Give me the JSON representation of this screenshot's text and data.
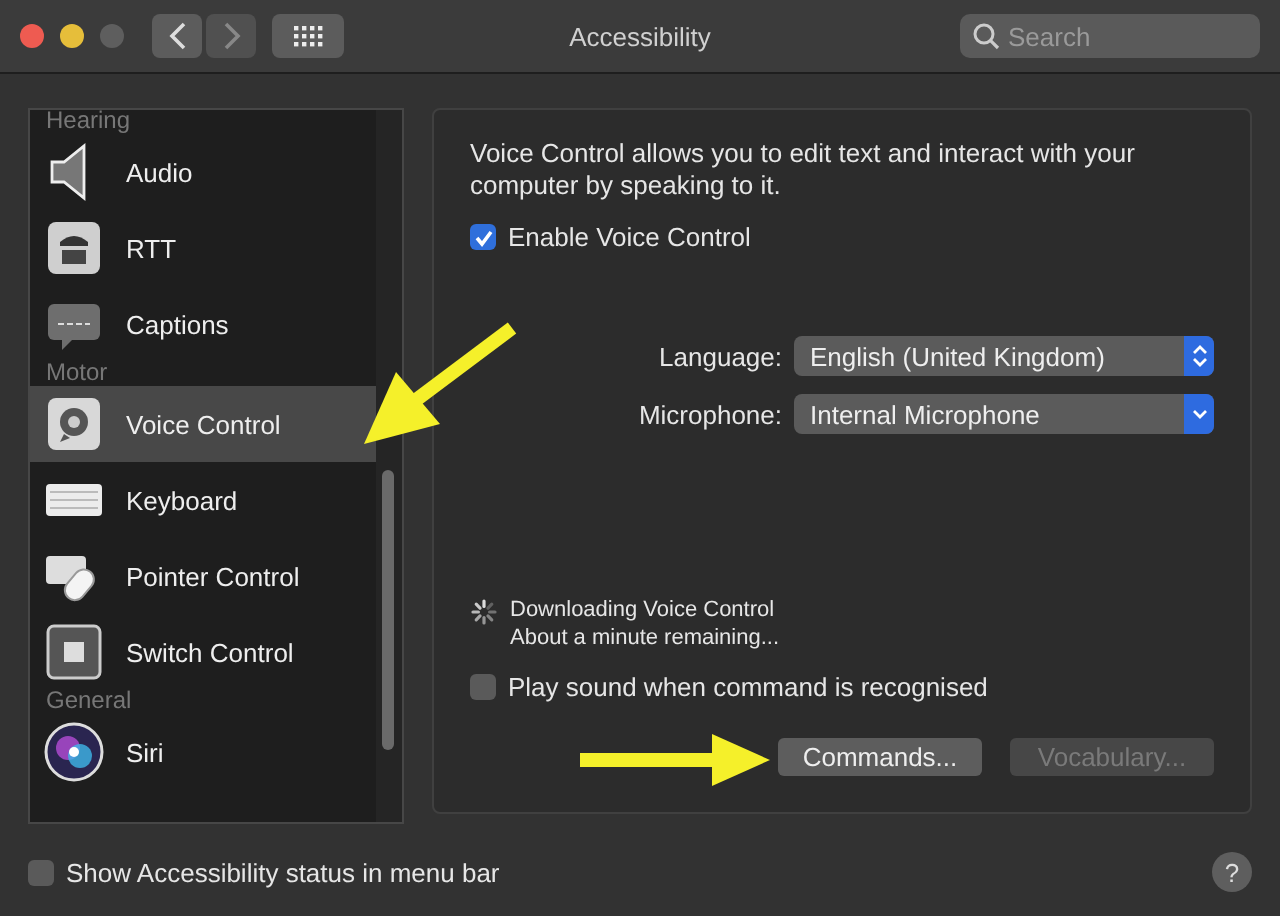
{
  "window": {
    "title": "Accessibility"
  },
  "toolbar": {
    "search": {
      "placeholder": "Search"
    }
  },
  "sidebar": {
    "items": [
      {
        "kind": "section",
        "label": "Hearing"
      },
      {
        "kind": "item",
        "label": "Audio",
        "selected": false
      },
      {
        "kind": "item",
        "label": "RTT",
        "selected": false
      },
      {
        "kind": "item",
        "label": "Captions",
        "selected": false
      },
      {
        "kind": "section",
        "label": "Motor"
      },
      {
        "kind": "item",
        "label": "Voice Control",
        "selected": true
      },
      {
        "kind": "item",
        "label": "Keyboard",
        "selected": false
      },
      {
        "kind": "item",
        "label": "Pointer Control",
        "selected": false
      },
      {
        "kind": "item",
        "label": "Switch Control",
        "selected": false
      },
      {
        "kind": "section",
        "label": "General"
      },
      {
        "kind": "item",
        "label": "Siri",
        "selected": false
      }
    ]
  },
  "panel": {
    "description": "Voice Control allows you to edit text and interact with your computer by speaking to it.",
    "enable": {
      "label": "Enable Voice Control",
      "checked": true
    },
    "language": {
      "label": "Language:",
      "value": "English (United Kingdom)",
      "kind": "popup"
    },
    "microphone": {
      "label": "Microphone:",
      "value": "Internal Microphone",
      "kind": "pulldown"
    },
    "download": {
      "title": "Downloading Voice Control",
      "status": "About a minute remaining..."
    },
    "play_sound": {
      "label": "Play sound when command is recognised",
      "checked": false
    },
    "buttons": [
      {
        "label": "Commands...",
        "disabled": false
      },
      {
        "label": "Vocabulary...",
        "disabled": true
      }
    ]
  },
  "footer": {
    "status_checkbox": {
      "label": "Show Accessibility status in menu bar",
      "checked": false
    },
    "help": "?"
  }
}
